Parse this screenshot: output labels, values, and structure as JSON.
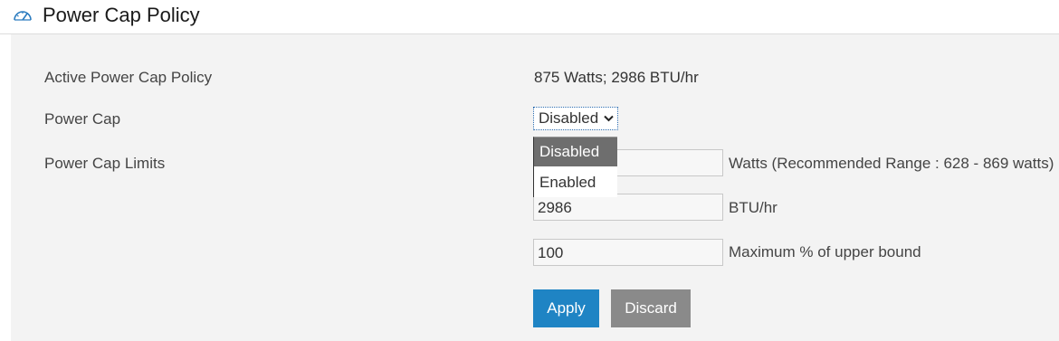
{
  "header": {
    "title": "Power Cap Policy",
    "icon": "gauge-icon"
  },
  "rows": {
    "active_policy": {
      "label": "Active Power Cap Policy",
      "value": "875 Watts; 2986 BTU/hr"
    },
    "power_cap": {
      "label": "Power Cap",
      "selected": "Disabled"
    },
    "limits": {
      "label": "Power Cap Limits"
    }
  },
  "limits": {
    "watts": {
      "value": "",
      "unit": "Watts (Recommended Range : 628 - 869 watts)"
    },
    "btu": {
      "value": "2986",
      "unit": "BTU/hr"
    },
    "percent": {
      "value": "100",
      "unit": "Maximum % of upper bound"
    }
  },
  "dropdown": {
    "options": [
      "Disabled",
      "Enabled"
    ],
    "highlighted": "Disabled"
  },
  "buttons": {
    "apply": "Apply",
    "discard": "Discard"
  },
  "colors": {
    "apply_bg": "#1f84c4",
    "discard_bg": "#8a8a8a",
    "highlight_bg": "#6e6e6e"
  }
}
